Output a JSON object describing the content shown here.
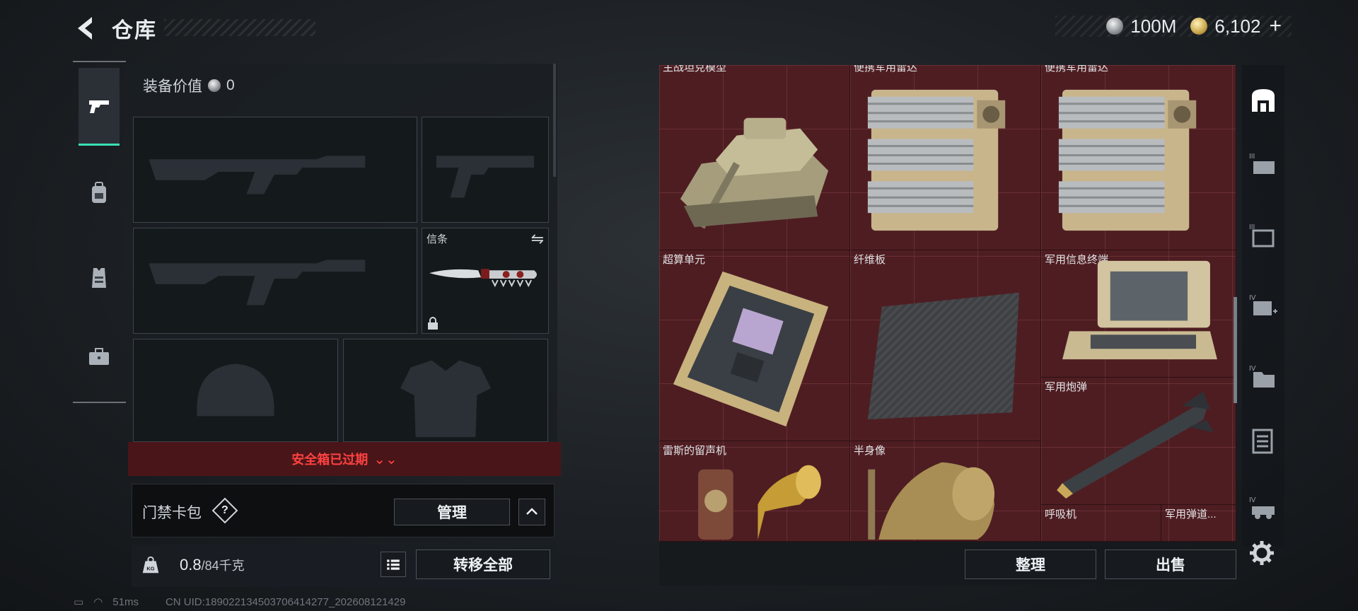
{
  "header": {
    "title": "仓库",
    "currency_silver": "100M",
    "currency_gold": "6,102",
    "plus": "+"
  },
  "left_tabs": [
    {
      "icon": "pistol-icon",
      "active": true
    },
    {
      "icon": "backpack-icon",
      "active": false
    },
    {
      "icon": "vest-icon",
      "active": false
    },
    {
      "icon": "briefcase-icon",
      "active": false
    }
  ],
  "loadout": {
    "equipment_value_label": "装备价值",
    "equipment_value": "0",
    "slots": {
      "primary_weapon": "",
      "pistol": "",
      "secondary_weapon": "",
      "melee_label": "信条",
      "helmet": "",
      "armor": ""
    }
  },
  "safebox": {
    "expired_text": "安全箱已过期"
  },
  "keycard": {
    "label": "门禁卡包",
    "help": "?",
    "manage": "管理"
  },
  "weight": {
    "current": "0.8",
    "capacity": "/84千克",
    "transfer_all": "转移全部"
  },
  "status": {
    "ping": "51ms",
    "uid": "CN UID:1890221345037064142​77_202608121429"
  },
  "stash": {
    "items": [
      {
        "label": "主战坦克模型"
      },
      {
        "label": "便携军用雷达"
      },
      {
        "label": "便携军用雷达"
      },
      {
        "label": "超算单元"
      },
      {
        "label": "纤维板"
      },
      {
        "label": "军用信息终端"
      },
      {
        "label": "军用炮弹"
      },
      {
        "label": "雷斯的留声机"
      },
      {
        "label": "半身像"
      },
      {
        "label": "呼吸机"
      },
      {
        "label": "军用弹道..."
      }
    ],
    "sort": "整理",
    "sell": "出售"
  },
  "filters": [
    {
      "icon": "all-items-icon"
    },
    {
      "icon": "tier-3-item-icon"
    },
    {
      "icon": "tier-3-container-icon"
    },
    {
      "icon": "tier-4-medical-icon"
    },
    {
      "icon": "tier-4-folder-icon"
    },
    {
      "icon": "document-icon"
    },
    {
      "icon": "tier-4-vehicle-icon"
    }
  ],
  "colors": {
    "accent": "#39e0b4",
    "warning": "#ff4242",
    "stash_bg": "#4e1d22"
  }
}
